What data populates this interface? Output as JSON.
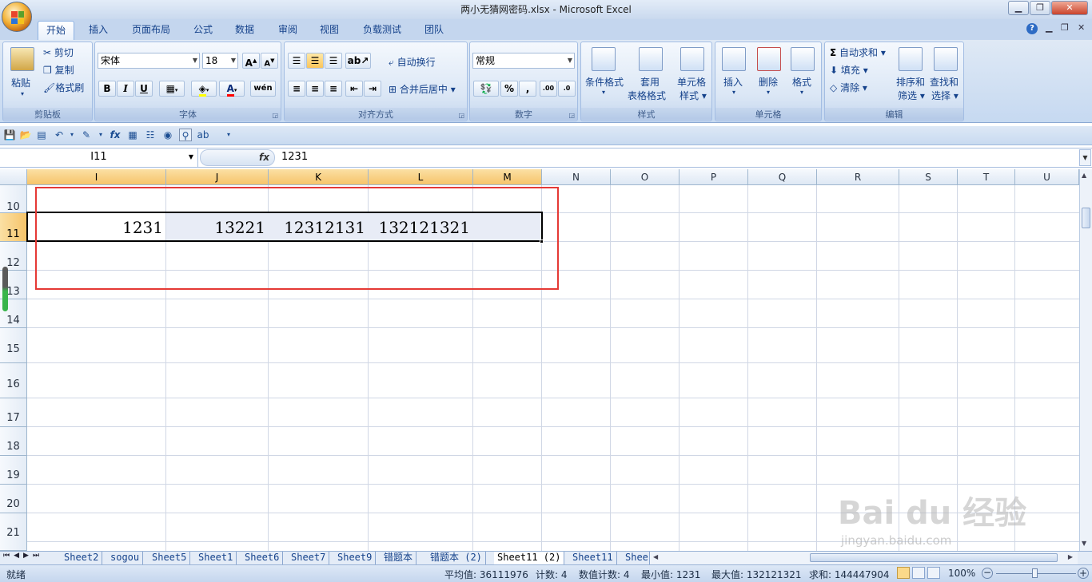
{
  "window": {
    "title": "两小无猜网密码.xlsx - Microsoft Excel"
  },
  "tabs": [
    "开始",
    "插入",
    "页面布局",
    "公式",
    "数据",
    "审阅",
    "视图",
    "负载测试",
    "团队"
  ],
  "clipboard": {
    "paste": "粘贴",
    "cut": "剪切",
    "copy": "复制",
    "format_painter": "格式刷",
    "label": "剪贴板"
  },
  "font": {
    "name": "宋体",
    "size": "18",
    "label": "字体",
    "bold": "B",
    "italic": "I",
    "underline": "U"
  },
  "alignment": {
    "wrap": "自动换行",
    "merge": "合并后居中",
    "label": "对齐方式"
  },
  "number": {
    "format": "常规",
    "label": "数字",
    "percent": "%",
    "comma": ","
  },
  "styles": {
    "conditional": "条件格式",
    "table_line1": "套用",
    "table_line2": "表格格式",
    "cell_line1": "单元格",
    "cell_line2": "样式",
    "label": "样式"
  },
  "cells": {
    "insert": "插入",
    "delete": "删除",
    "format": "格式",
    "label": "单元格"
  },
  "editing": {
    "autosum": "自动求和",
    "fill": "填充",
    "clear": "清除",
    "sort_line1": "排序和",
    "sort_line2": "筛选",
    "find_line1": "查找和",
    "find_line2": "选择",
    "label": "编辑"
  },
  "formula_bar": {
    "name_box": "I11",
    "fx": "fx",
    "value": "1231"
  },
  "columns": [
    "I",
    "J",
    "K",
    "L",
    "M",
    "N",
    "O",
    "P",
    "Q",
    "R",
    "S",
    "T",
    "U"
  ],
  "rows": [
    "10",
    "11",
    "12",
    "13",
    "14",
    "15",
    "16",
    "17",
    "18",
    "19",
    "20",
    "21"
  ],
  "row11_values": [
    "1231",
    "13221",
    "12312131",
    "132121321"
  ],
  "sheets": [
    "Sheet2",
    "sogou",
    "Sheet5",
    "Sheet1",
    "Sheet6",
    "Sheet7",
    "Sheet9",
    "错题本",
    "错题本 (2)",
    "Sheet11 (2)",
    "Sheet11",
    "Shee"
  ],
  "active_sheet": "Sheet11 (2)",
  "status": {
    "ready": "就绪",
    "average": "平均值: 36111976",
    "count": "计数: 4",
    "numeric_count": "数值计数: 4",
    "min": "最小值: 1231",
    "max": "最大值: 132121321",
    "sum": "求和: 144447904",
    "zoom": "100%"
  },
  "watermark": {
    "brand": "Bai du 经验",
    "url": "jingyan.baidu.com"
  },
  "colors": {
    "selection_border": "#000000",
    "highlight_box": "#e53935",
    "header_selected": "#f6c46a"
  }
}
